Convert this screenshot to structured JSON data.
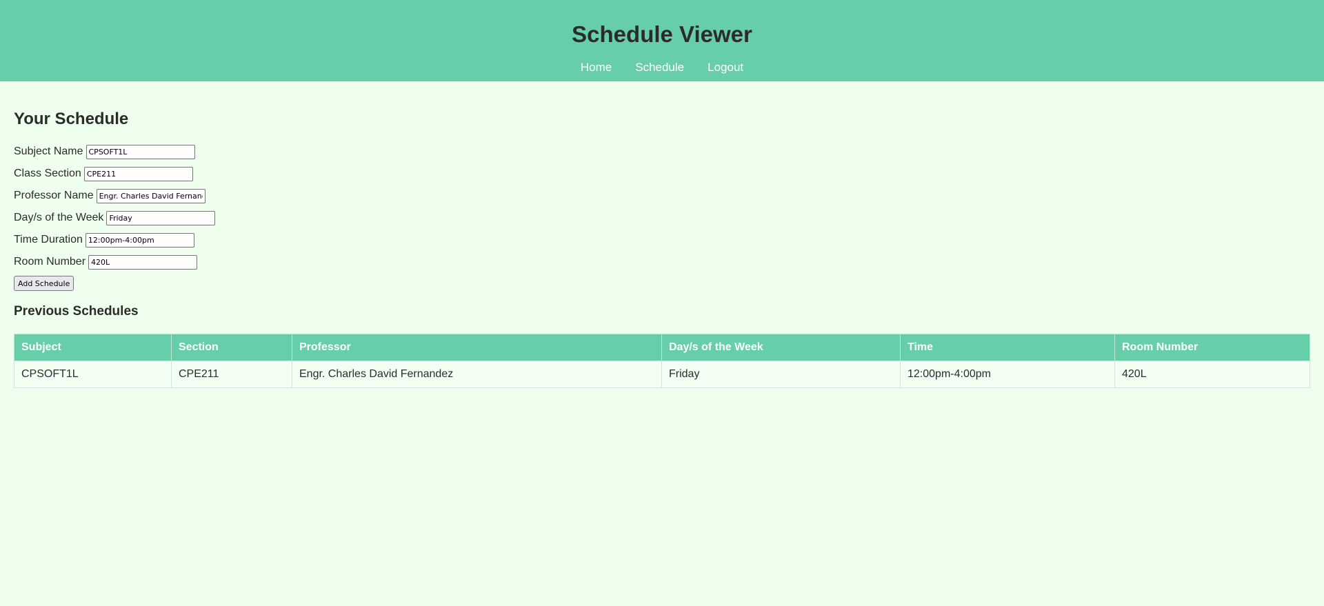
{
  "header": {
    "title": "Schedule Viewer",
    "nav": [
      "Home",
      "Schedule",
      "Logout"
    ]
  },
  "form": {
    "title": "Your Schedule",
    "fields": [
      {
        "label": "Subject Name",
        "value": "CPSOFT1L"
      },
      {
        "label": "Class Section",
        "value": "CPE211"
      },
      {
        "label": "Professor Name",
        "value": "Engr. Charles David Fernandez"
      },
      {
        "label": "Day/s of the Week",
        "value": "Friday"
      },
      {
        "label": "Time Duration",
        "value": "12:00pm-4:00pm"
      },
      {
        "label": "Room Number",
        "value": "420L"
      }
    ],
    "submit_label": "Add Schedule"
  },
  "previous": {
    "title": "Previous Schedules",
    "columns": [
      "Subject",
      "Section",
      "Professor",
      "Day/s of the Week",
      "Time",
      "Room Number"
    ],
    "rows": [
      [
        "CPSOFT1L",
        "CPE211",
        "Engr. Charles David Fernandez",
        "Friday",
        "12:00pm-4:00pm",
        "420L"
      ]
    ]
  },
  "colors": {
    "header_bg": "#66cfaa",
    "page_bg": "#efffee"
  }
}
